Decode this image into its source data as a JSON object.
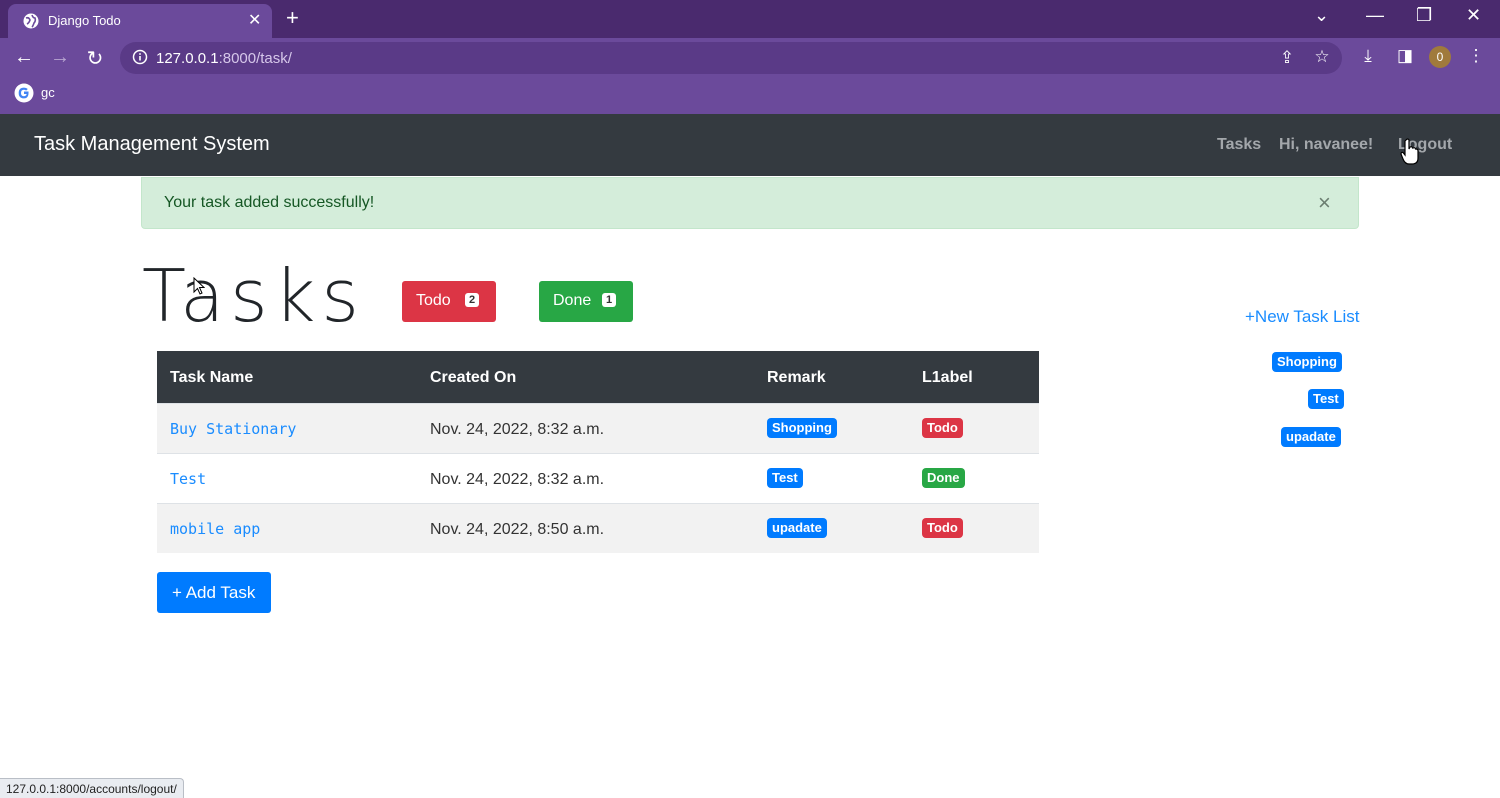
{
  "browser": {
    "tab_title": "Django Todo",
    "url_host": "127.0.0.1",
    "url_rest": ":8000/task/",
    "bookmark_label": "gc",
    "profile_initial": "0",
    "status_url": "127.0.0.1:8000/accounts/logout/"
  },
  "navbar": {
    "brand": "Task Management System",
    "links": [
      "Tasks",
      "Hi, navanee!",
      "Logout"
    ]
  },
  "alert": {
    "message": "Your task added successfully!",
    "close": "×"
  },
  "header": {
    "title": "Tasks",
    "todo_label": "Todo",
    "todo_count": "2",
    "done_label": "Done",
    "done_count": "1"
  },
  "sidebar": {
    "new_list": "+New Task List",
    "lists": [
      "Shopping",
      "Test",
      "upadate"
    ]
  },
  "table": {
    "headers": [
      "Task Name",
      "Created On",
      "Remark",
      "L1abel"
    ],
    "rows": [
      {
        "name": "Buy Stationary",
        "created": "Nov. 24, 2022, 8:32 a.m.",
        "remark": "Shopping",
        "label": "Todo"
      },
      {
        "name": "Test",
        "created": "Nov. 24, 2022, 8:32 a.m.",
        "remark": "Test",
        "label": "Done"
      },
      {
        "name": "mobile app",
        "created": "Nov. 24, 2022, 8:50 a.m.",
        "remark": "upadate",
        "label": "Todo"
      }
    ]
  },
  "add_task": "+ Add Task",
  "colors": {
    "navbar": "#343a40",
    "primary": "#007bff",
    "danger": "#dc3545",
    "success": "#28a745",
    "alert_bg": "#d4edda",
    "browser_frame": "#6b4a9b"
  }
}
